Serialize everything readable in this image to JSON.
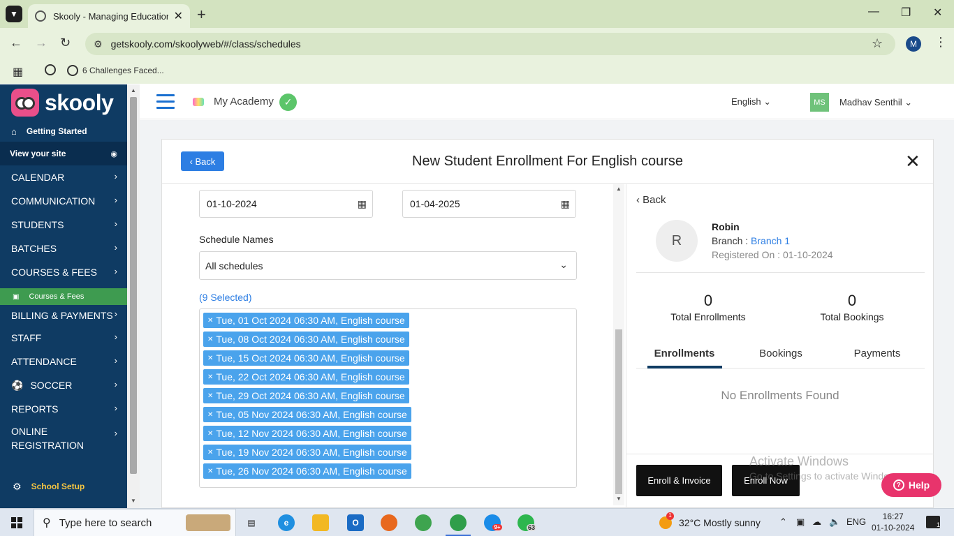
{
  "browser": {
    "tab_title": "Skooly - Managing Educational",
    "url": "getskooly.com/skoolyweb/#/class/schedules",
    "bookmark": "6 Challenges Faced...",
    "profile_initial": "M"
  },
  "sidebar": {
    "brand": "skooly",
    "getting_started": "Getting Started",
    "view_site": "View your site",
    "menu": {
      "calendar": "CALENDAR",
      "communication": "COMMUNICATION",
      "students": "STUDENTS",
      "batches": "BATCHES",
      "courses_fees": "COURSES & FEES",
      "courses_fees_sub": "Courses & Fees",
      "billing": "BILLING & PAYMENTS",
      "staff": "STAFF",
      "attendance": "ATTENDANCE",
      "soccer": "SOCCER",
      "reports": "REPORTS",
      "online_1": "ONLINE",
      "online_2": "REGISTRATION"
    },
    "school_setup": "School Setup"
  },
  "header": {
    "academy": "My Academy",
    "language": "English",
    "avatar_initials": "MS",
    "user_name": "Madhav Senthil"
  },
  "modal": {
    "back_label": "Back",
    "title": "New Student Enrollment For English course",
    "start_date": "01-10-2024",
    "end_date": "01-04-2025",
    "schedule_label": "Schedule Names",
    "schedule_value": "All schedules",
    "selected_count": "(9 Selected)",
    "schedules": [
      "Tue, 01 Oct 2024 06:30 AM, English course",
      "Tue, 08 Oct 2024 06:30 AM, English course",
      "Tue, 15 Oct 2024 06:30 AM, English course",
      "Tue, 22 Oct 2024 06:30 AM, English course",
      "Tue, 29 Oct 2024 06:30 AM, English course",
      "Tue, 05 Nov 2024 06:30 AM, English course",
      "Tue, 12 Nov 2024 06:30 AM, English course",
      "Tue, 19 Nov 2024 06:30 AM, English course",
      "Tue, 26 Nov 2024 06:30 AM, English course"
    ]
  },
  "student": {
    "back_label": "Back",
    "initial": "R",
    "name": "Robin",
    "branch_label": "Branch : ",
    "branch_value": "Branch 1",
    "registered": "Registered On : 01-10-2024",
    "total_enrollments_value": "0",
    "total_enrollments_label": "Total Enrollments",
    "total_bookings_value": "0",
    "total_bookings_label": "Total Bookings",
    "tabs": [
      "Enrollments",
      "Bookings",
      "Payments"
    ],
    "empty": "No Enrollments Found",
    "enroll_invoice": "Enroll & Invoice",
    "enroll_now": "Enroll Now"
  },
  "watermark": {
    "line1": "Activate Windows",
    "line2": "Go to Settings to activate Windows."
  },
  "help_label": "Help",
  "taskbar": {
    "search_placeholder": "Type here to search",
    "skype_badge": "9+",
    "whatsapp_badge": "63",
    "weather_badge": "1",
    "weather": "32°C  Mostly sunny",
    "lang": "ENG",
    "time": "16:27",
    "date": "01-10-2024",
    "notif_count": "1"
  }
}
